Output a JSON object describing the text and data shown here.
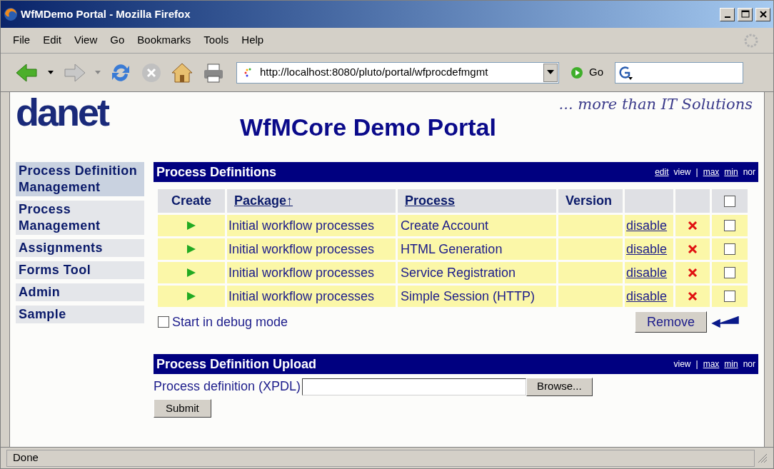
{
  "window": {
    "title": "WfMDemo Portal - Mozilla Firefox"
  },
  "menu": [
    "File",
    "Edit",
    "View",
    "Go",
    "Bookmarks",
    "Tools",
    "Help"
  ],
  "toolbar": {
    "url": "http://localhost:8080/pluto/portal/wfprocdefmgmt",
    "go": "Go"
  },
  "header": {
    "logo": "danet",
    "slogan": "... more than IT Solutions",
    "title": "WfMCore Demo Portal"
  },
  "sidebar": {
    "items": [
      {
        "label": "Process Definition Management",
        "selected": true
      },
      {
        "label": "Process Management",
        "selected": false
      },
      {
        "label": "Assignments",
        "selected": false
      },
      {
        "label": "Forms Tool",
        "selected": false
      },
      {
        "label": "Admin",
        "selected": false
      },
      {
        "label": "Sample",
        "selected": false
      }
    ]
  },
  "definitions_panel": {
    "title": "Process Definitions",
    "modes": [
      {
        "label": "edit",
        "link": true
      },
      {
        "label": "view",
        "link": false
      },
      {
        "label": "|"
      },
      {
        "label": "max",
        "link": true
      },
      {
        "label": "min",
        "link": true
      },
      {
        "label": "nor",
        "link": false
      }
    ],
    "columns": [
      {
        "label": "Create",
        "link": false
      },
      {
        "label": "Package↑",
        "link": true
      },
      {
        "label": "Process",
        "link": true
      },
      {
        "label": "Version",
        "link": false
      }
    ],
    "header_checked": false,
    "rows": [
      {
        "package": "Initial workflow processes",
        "process": "Create Account",
        "action": "disable",
        "checked": false
      },
      {
        "package": "Initial workflow processes",
        "process": "HTML Generation",
        "action": "disable",
        "checked": false
      },
      {
        "package": "Initial workflow processes",
        "process": "Service Registration",
        "action": "disable",
        "checked": false
      },
      {
        "package": "Initial workflow processes",
        "process": "Simple Session (HTTP)",
        "action": "disable",
        "checked": false
      }
    ],
    "debug": {
      "label": "Start in debug mode",
      "checked": false
    },
    "remove": "Remove"
  },
  "upload_panel": {
    "title": "Process Definition Upload",
    "modes": [
      {
        "label": "view",
        "link": false
      },
      {
        "label": "|"
      },
      {
        "label": "max",
        "link": true
      },
      {
        "label": "min",
        "link": true
      },
      {
        "label": "nor",
        "link": false
      }
    ],
    "field_label": "Process definition (XPDL)",
    "browse": "Browse...",
    "submit": "Submit"
  },
  "status_bar": {
    "text": "Done"
  }
}
